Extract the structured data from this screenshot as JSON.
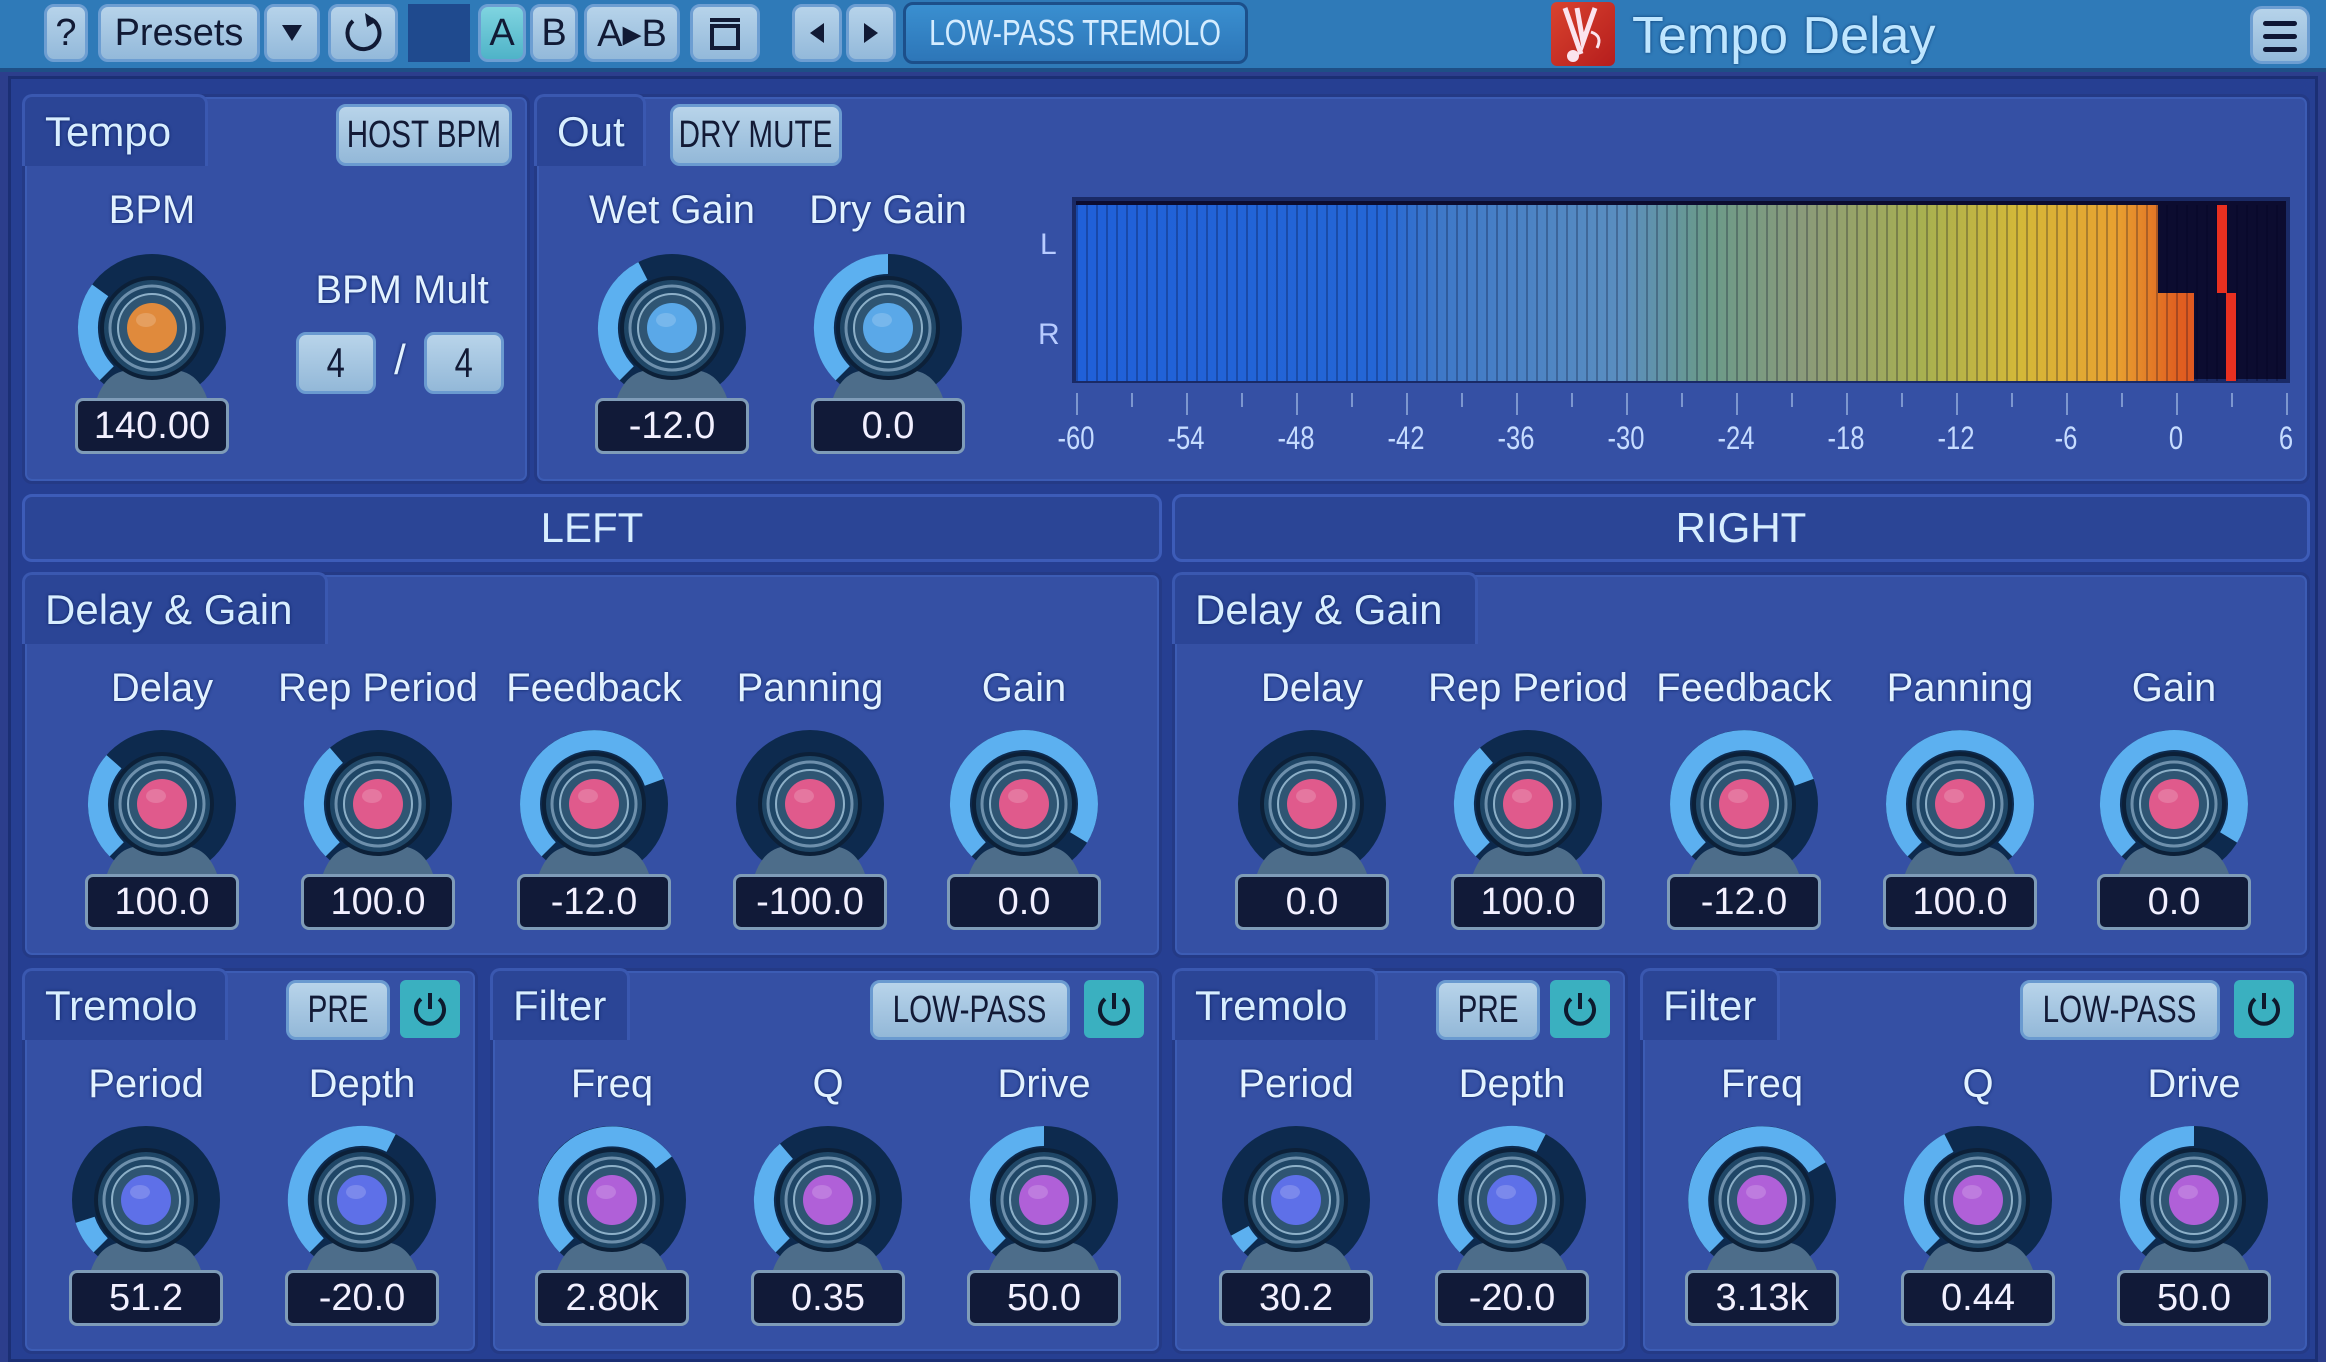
{
  "toolbar": {
    "help_label": "?",
    "presets_label": "Presets",
    "presets_dropdown_icon": "triangle-down",
    "reset_icon": "undo-arrow",
    "ab": [
      {
        "label": "A",
        "active": true
      },
      {
        "label": "B",
        "active": false
      },
      {
        "label": "A▸B",
        "active": false
      }
    ],
    "compare_icon": "window-frame",
    "prev_icon": "triangle-left",
    "next_icon": "triangle-right",
    "preset_name": "LOW-PASS TREMOLO",
    "app_title": "Tempo Delay",
    "menu_icon": "hamburger"
  },
  "tempo": {
    "title": "Tempo",
    "host_bpm_label": "HOST BPM",
    "bpm": {
      "label": "BPM",
      "value": "140.00",
      "fraction": 0.3,
      "color": "#e08a3c"
    },
    "bpm_mult": {
      "label": "BPM Mult",
      "numerator": "4",
      "separator": "/",
      "denominator": "4"
    }
  },
  "out": {
    "title": "Out",
    "dry_mute_label": "DRY MUTE",
    "wet_gain": {
      "label": "Wet Gain",
      "value": "-12.0",
      "fraction": 0.4,
      "color": "#5aa8e8"
    },
    "dry_gain": {
      "label": "Dry Gain",
      "value": "0.0",
      "fraction": 0.5,
      "color": "#5aa8e8"
    }
  },
  "meter": {
    "channels": [
      {
        "label": "L",
        "level_db": -1.0,
        "peak_db": 2.5
      },
      {
        "label": "R",
        "level_db": 1.0,
        "peak_db": 3.0
      }
    ],
    "range_db": [
      -60,
      6
    ],
    "ticks": [
      "-60",
      "-54",
      "-48",
      "-42",
      "-36",
      "-30",
      "-24",
      "-18",
      "-12",
      "-6",
      "0",
      "6"
    ]
  },
  "channels": [
    {
      "name": "LEFT",
      "delay_gain": {
        "title": "Delay & Gain",
        "knobs": [
          {
            "label": "Delay",
            "value": "100.0",
            "fraction": 0.32
          },
          {
            "label": "Rep Period",
            "value": "100.0",
            "fraction": 0.35
          },
          {
            "label": "Feedback",
            "value": "-12.0",
            "fraction": 0.76
          },
          {
            "label": "Panning",
            "value": "-100.0",
            "fraction": 0.0
          },
          {
            "label": "Gain",
            "value": "0.0",
            "fraction": 0.95
          }
        ]
      },
      "tremolo": {
        "title": "Tremolo",
        "mode_label": "PRE",
        "enabled": true,
        "knobs": [
          {
            "label": "Period",
            "value": "51.2",
            "fraction": 0.1
          },
          {
            "label": "Depth",
            "value": "-20.0",
            "fraction": 0.6
          }
        ]
      },
      "filter": {
        "title": "Filter",
        "type_label": "LOW-PASS",
        "enabled": true,
        "knobs": [
          {
            "label": "Freq",
            "value": "2.80k",
            "fraction": 0.7
          },
          {
            "label": "Q",
            "value": "0.35",
            "fraction": 0.35
          },
          {
            "label": "Drive",
            "value": "50.0",
            "fraction": 0.5
          }
        ]
      }
    },
    {
      "name": "RIGHT",
      "delay_gain": {
        "title": "Delay & Gain",
        "knobs": [
          {
            "label": "Delay",
            "value": "0.0",
            "fraction": 0.0
          },
          {
            "label": "Rep Period",
            "value": "100.0",
            "fraction": 0.35
          },
          {
            "label": "Feedback",
            "value": "-12.0",
            "fraction": 0.76
          },
          {
            "label": "Panning",
            "value": "100.0",
            "fraction": 1.0
          },
          {
            "label": "Gain",
            "value": "0.0",
            "fraction": 0.95
          }
        ]
      },
      "tremolo": {
        "title": "Tremolo",
        "mode_label": "PRE",
        "enabled": true,
        "knobs": [
          {
            "label": "Period",
            "value": "30.2",
            "fraction": 0.06
          },
          {
            "label": "Depth",
            "value": "-20.0",
            "fraction": 0.6
          }
        ]
      },
      "filter": {
        "title": "Filter",
        "type_label": "LOW-PASS",
        "enabled": true,
        "knobs": [
          {
            "label": "Freq",
            "value": "3.13k",
            "fraction": 0.72
          },
          {
            "label": "Q",
            "value": "0.44",
            "fraction": 0.4
          },
          {
            "label": "Drive",
            "value": "50.0",
            "fraction": 0.5
          }
        ]
      }
    }
  ],
  "colors": {
    "delay_knob_cap": "#e05a8c",
    "tremolo_knob_cap": "#5e70e8",
    "filter_knob_cap": "#b060d8",
    "arc": "#5cb0f0",
    "power_on": "#3ab0c0"
  }
}
